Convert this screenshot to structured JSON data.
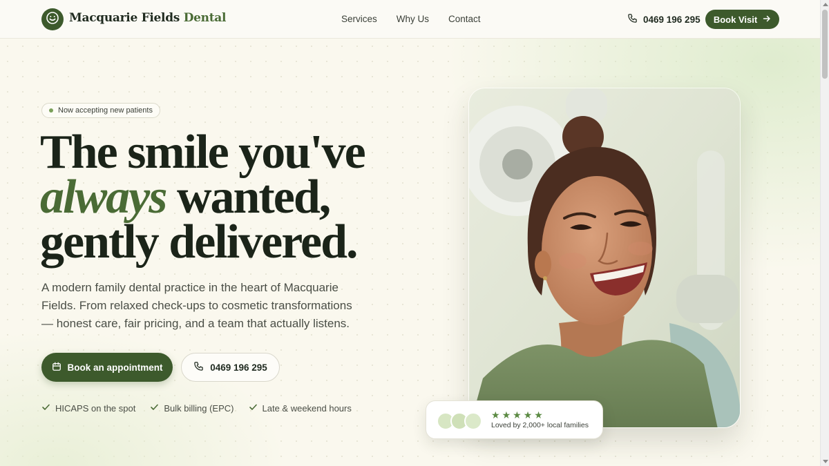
{
  "header": {
    "brand_name": "Macquarie Fields",
    "brand_accent": "Dental",
    "nav": [
      {
        "label": "Services"
      },
      {
        "label": "Why Us"
      },
      {
        "label": "Contact"
      }
    ],
    "phone": "0469 196 295",
    "book_label": "Book Visit"
  },
  "hero": {
    "badge": "Now accepting new patients",
    "headline_line1": "The smile you've",
    "headline_italic": "always",
    "headline_line2_rest": " wanted,",
    "headline_line3": "gently delivered.",
    "lede": "A modern family dental practice in the heart of Macquarie Fields. From relaxed check-ups to cosmetic transformations — honest care, fair pricing, and a team that actually listens.",
    "cta_primary": "Book an appointment",
    "cta_secondary": "0469 196 295",
    "checks": [
      {
        "label": "HICAPS on the spot"
      },
      {
        "label": "Bulk billing (EPC)"
      },
      {
        "label": "Late & weekend hours"
      }
    ]
  },
  "review": {
    "rating": 5,
    "text": "Loved by 2,000+ local families"
  },
  "colors": {
    "brand_green": "#3d5a2c",
    "accent_green": "#4a6b35",
    "background": "#faf8ee",
    "star": "#5b8a43"
  },
  "icons": {
    "logo": "smile-icon",
    "phone": "phone-icon",
    "arrow": "arrow-right-icon",
    "calendar": "calendar-icon",
    "check": "check-icon",
    "star": "star-icon"
  }
}
